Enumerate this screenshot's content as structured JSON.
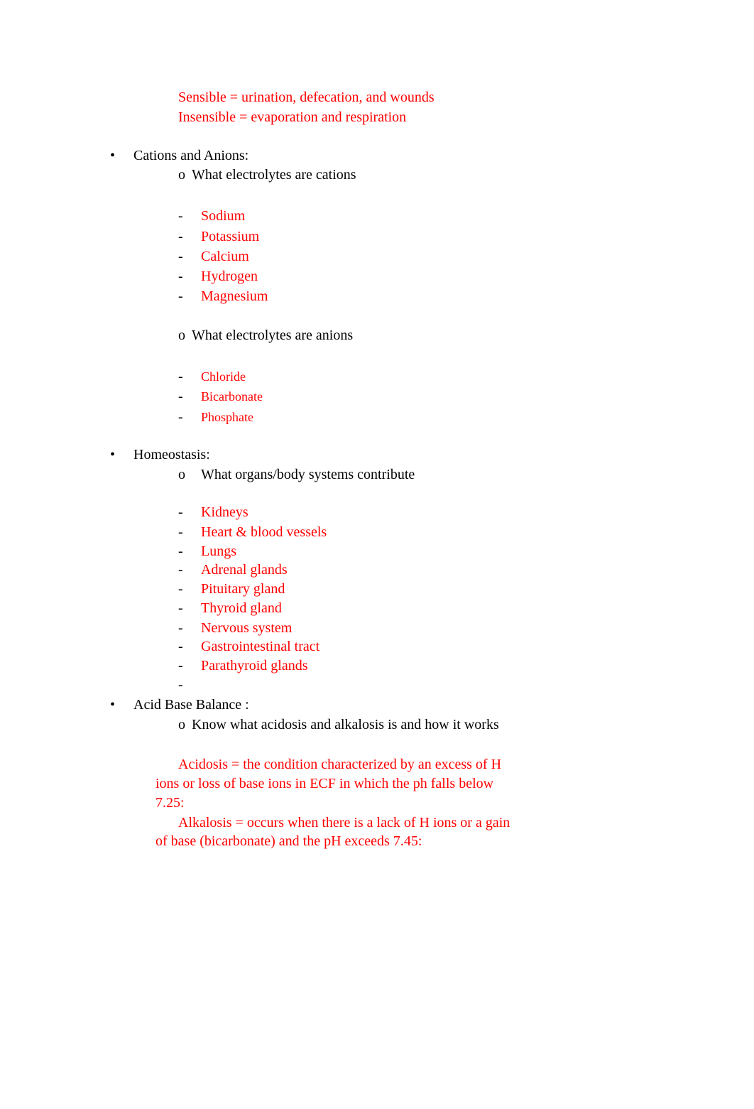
{
  "loss_types": {
    "sensible": "Sensible = urination, defecation, and wounds",
    "insensible": "Insensible = evaporation and respiration"
  },
  "markers": {
    "bullet": "•",
    "sub": "o",
    "dash": "-"
  },
  "colors": {
    "answer": "#ff0000",
    "text": "#000000"
  },
  "cations_anions": {
    "heading": "Cations and Anions:",
    "cations_question": "What electrolytes are cations",
    "cations": [
      "Sodium",
      "Potassium",
      "Calcium",
      "Hydrogen",
      "Magnesium"
    ],
    "anions_question": "What electrolytes are anions",
    "anions": [
      "Chloride",
      "Bicarbonate",
      "Phosphate"
    ]
  },
  "homeostasis": {
    "heading": "Homeostasis:",
    "question": "What organs/body systems contribute",
    "organs": [
      "Kidneys",
      "Heart & blood vessels",
      "Lungs",
      "Adrenal glands",
      "Pituitary gland",
      "Thyroid gland",
      "Nervous system",
      "Gastrointestinal tract",
      "Parathyroid glands"
    ]
  },
  "acid_base": {
    "heading": "Acid Base Balance :",
    "question": "Know what acidosis and alkalosis is and how it works",
    "acidosis_lines": [
      "Acidosis = the condition characterized by an excess of H",
      "ions or loss of base ions in ECF in which the ph falls below",
      "7.25:"
    ],
    "alkalosis_lines": [
      "Alkalosis = occurs when there is a lack of H ions or a gain",
      "of base (bicarbonate) and the pH exceeds 7.45:"
    ]
  }
}
